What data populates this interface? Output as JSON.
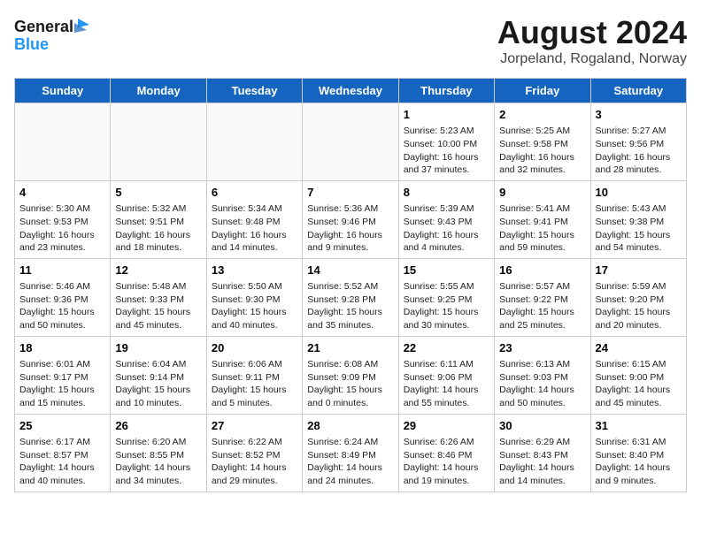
{
  "logo": {
    "line1": "General",
    "line2": "Blue"
  },
  "title": "August 2024",
  "subtitle": "Jorpeland, Rogaland, Norway",
  "headers": [
    "Sunday",
    "Monday",
    "Tuesday",
    "Wednesday",
    "Thursday",
    "Friday",
    "Saturday"
  ],
  "weeks": [
    [
      {
        "day": "",
        "text": "",
        "empty": true
      },
      {
        "day": "",
        "text": "",
        "empty": true
      },
      {
        "day": "",
        "text": "",
        "empty": true
      },
      {
        "day": "",
        "text": "",
        "empty": true
      },
      {
        "day": "1",
        "text": "Sunrise: 5:23 AM\nSunset: 10:00 PM\nDaylight: 16 hours\nand 37 minutes.",
        "empty": false
      },
      {
        "day": "2",
        "text": "Sunrise: 5:25 AM\nSunset: 9:58 PM\nDaylight: 16 hours\nand 32 minutes.",
        "empty": false
      },
      {
        "day": "3",
        "text": "Sunrise: 5:27 AM\nSunset: 9:56 PM\nDaylight: 16 hours\nand 28 minutes.",
        "empty": false
      }
    ],
    [
      {
        "day": "4",
        "text": "Sunrise: 5:30 AM\nSunset: 9:53 PM\nDaylight: 16 hours\nand 23 minutes.",
        "empty": false
      },
      {
        "day": "5",
        "text": "Sunrise: 5:32 AM\nSunset: 9:51 PM\nDaylight: 16 hours\nand 18 minutes.",
        "empty": false
      },
      {
        "day": "6",
        "text": "Sunrise: 5:34 AM\nSunset: 9:48 PM\nDaylight: 16 hours\nand 14 minutes.",
        "empty": false
      },
      {
        "day": "7",
        "text": "Sunrise: 5:36 AM\nSunset: 9:46 PM\nDaylight: 16 hours\nand 9 minutes.",
        "empty": false
      },
      {
        "day": "8",
        "text": "Sunrise: 5:39 AM\nSunset: 9:43 PM\nDaylight: 16 hours\nand 4 minutes.",
        "empty": false
      },
      {
        "day": "9",
        "text": "Sunrise: 5:41 AM\nSunset: 9:41 PM\nDaylight: 15 hours\nand 59 minutes.",
        "empty": false
      },
      {
        "day": "10",
        "text": "Sunrise: 5:43 AM\nSunset: 9:38 PM\nDaylight: 15 hours\nand 54 minutes.",
        "empty": false
      }
    ],
    [
      {
        "day": "11",
        "text": "Sunrise: 5:46 AM\nSunset: 9:36 PM\nDaylight: 15 hours\nand 50 minutes.",
        "empty": false
      },
      {
        "day": "12",
        "text": "Sunrise: 5:48 AM\nSunset: 9:33 PM\nDaylight: 15 hours\nand 45 minutes.",
        "empty": false
      },
      {
        "day": "13",
        "text": "Sunrise: 5:50 AM\nSunset: 9:30 PM\nDaylight: 15 hours\nand 40 minutes.",
        "empty": false
      },
      {
        "day": "14",
        "text": "Sunrise: 5:52 AM\nSunset: 9:28 PM\nDaylight: 15 hours\nand 35 minutes.",
        "empty": false
      },
      {
        "day": "15",
        "text": "Sunrise: 5:55 AM\nSunset: 9:25 PM\nDaylight: 15 hours\nand 30 minutes.",
        "empty": false
      },
      {
        "day": "16",
        "text": "Sunrise: 5:57 AM\nSunset: 9:22 PM\nDaylight: 15 hours\nand 25 minutes.",
        "empty": false
      },
      {
        "day": "17",
        "text": "Sunrise: 5:59 AM\nSunset: 9:20 PM\nDaylight: 15 hours\nand 20 minutes.",
        "empty": false
      }
    ],
    [
      {
        "day": "18",
        "text": "Sunrise: 6:01 AM\nSunset: 9:17 PM\nDaylight: 15 hours\nand 15 minutes.",
        "empty": false
      },
      {
        "day": "19",
        "text": "Sunrise: 6:04 AM\nSunset: 9:14 PM\nDaylight: 15 hours\nand 10 minutes.",
        "empty": false
      },
      {
        "day": "20",
        "text": "Sunrise: 6:06 AM\nSunset: 9:11 PM\nDaylight: 15 hours\nand 5 minutes.",
        "empty": false
      },
      {
        "day": "21",
        "text": "Sunrise: 6:08 AM\nSunset: 9:09 PM\nDaylight: 15 hours\nand 0 minutes.",
        "empty": false
      },
      {
        "day": "22",
        "text": "Sunrise: 6:11 AM\nSunset: 9:06 PM\nDaylight: 14 hours\nand 55 minutes.",
        "empty": false
      },
      {
        "day": "23",
        "text": "Sunrise: 6:13 AM\nSunset: 9:03 PM\nDaylight: 14 hours\nand 50 minutes.",
        "empty": false
      },
      {
        "day": "24",
        "text": "Sunrise: 6:15 AM\nSunset: 9:00 PM\nDaylight: 14 hours\nand 45 minutes.",
        "empty": false
      }
    ],
    [
      {
        "day": "25",
        "text": "Sunrise: 6:17 AM\nSunset: 8:57 PM\nDaylight: 14 hours\nand 40 minutes.",
        "empty": false
      },
      {
        "day": "26",
        "text": "Sunrise: 6:20 AM\nSunset: 8:55 PM\nDaylight: 14 hours\nand 34 minutes.",
        "empty": false
      },
      {
        "day": "27",
        "text": "Sunrise: 6:22 AM\nSunset: 8:52 PM\nDaylight: 14 hours\nand 29 minutes.",
        "empty": false
      },
      {
        "day": "28",
        "text": "Sunrise: 6:24 AM\nSunset: 8:49 PM\nDaylight: 14 hours\nand 24 minutes.",
        "empty": false
      },
      {
        "day": "29",
        "text": "Sunrise: 6:26 AM\nSunset: 8:46 PM\nDaylight: 14 hours\nand 19 minutes.",
        "empty": false
      },
      {
        "day": "30",
        "text": "Sunrise: 6:29 AM\nSunset: 8:43 PM\nDaylight: 14 hours\nand 14 minutes.",
        "empty": false
      },
      {
        "day": "31",
        "text": "Sunrise: 6:31 AM\nSunset: 8:40 PM\nDaylight: 14 hours\nand 9 minutes.",
        "empty": false
      }
    ]
  ]
}
